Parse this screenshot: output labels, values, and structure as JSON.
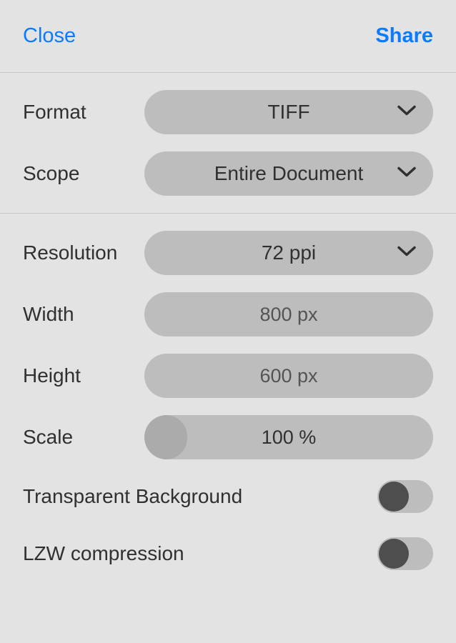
{
  "header": {
    "close_label": "Close",
    "share_label": "Share"
  },
  "format": {
    "label": "Format",
    "value": "TIFF"
  },
  "scope": {
    "label": "Scope",
    "value": "Entire Document"
  },
  "resolution": {
    "label": "Resolution",
    "value": "72 ppi"
  },
  "width": {
    "label": "Width",
    "value": "800 px"
  },
  "height": {
    "label": "Height",
    "value": "600 px"
  },
  "scale": {
    "label": "Scale",
    "value": "100 %"
  },
  "transparent_bg": {
    "label": "Transparent Background",
    "enabled": false
  },
  "lzw": {
    "label": "LZW compression",
    "enabled": false
  }
}
